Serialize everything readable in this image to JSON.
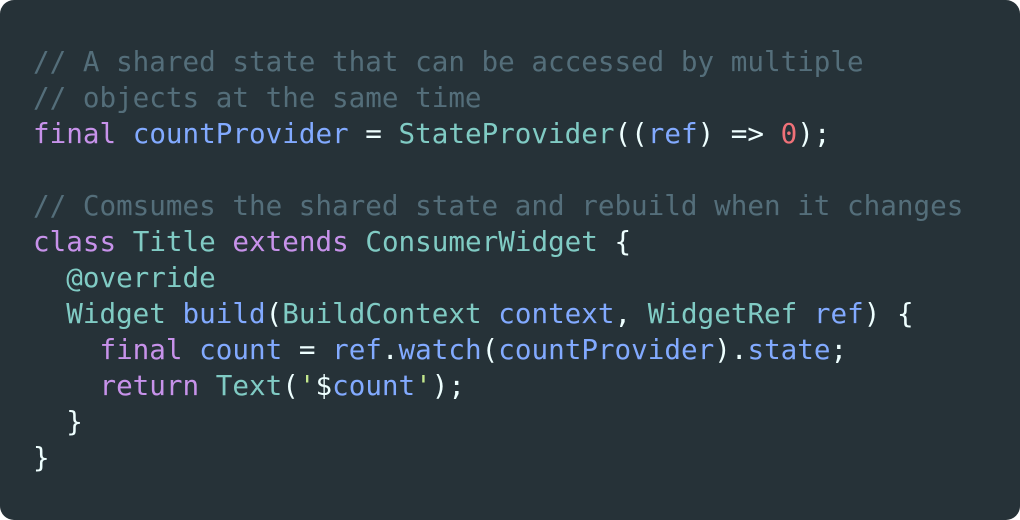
{
  "colors": {
    "background": "#263238",
    "comment": "#546e7a",
    "keyword": "#c792ea",
    "type": "#80cbc4",
    "identifier": "#82aaff",
    "number": "#f07178",
    "string": "#c3e88d",
    "plain": "#eeffff"
  },
  "code": {
    "lines": [
      [
        {
          "t": "// A shared state that can be accessed by multiple",
          "k": "comment"
        }
      ],
      [
        {
          "t": "// objects at the same time",
          "k": "comment"
        }
      ],
      [
        {
          "t": "final",
          "k": "keyword"
        },
        {
          "t": " ",
          "k": "plain"
        },
        {
          "t": "countProvider",
          "k": "identifier"
        },
        {
          "t": " = ",
          "k": "plain"
        },
        {
          "t": "StateProvider",
          "k": "type"
        },
        {
          "t": "((",
          "k": "plain"
        },
        {
          "t": "ref",
          "k": "identifier"
        },
        {
          "t": ") => ",
          "k": "plain"
        },
        {
          "t": "0",
          "k": "number"
        },
        {
          "t": ");",
          "k": "plain"
        }
      ],
      [],
      [
        {
          "t": "// Comsumes the shared state and rebuild when it changes",
          "k": "comment"
        }
      ],
      [
        {
          "t": "class",
          "k": "keyword"
        },
        {
          "t": " ",
          "k": "plain"
        },
        {
          "t": "Title",
          "k": "type"
        },
        {
          "t": " ",
          "k": "plain"
        },
        {
          "t": "extends",
          "k": "keyword"
        },
        {
          "t": " ",
          "k": "plain"
        },
        {
          "t": "ConsumerWidget",
          "k": "type"
        },
        {
          "t": " {",
          "k": "plain"
        }
      ],
      [
        {
          "t": "  ",
          "k": "plain"
        },
        {
          "t": "@override",
          "k": "type"
        }
      ],
      [
        {
          "t": "  ",
          "k": "plain"
        },
        {
          "t": "Widget",
          "k": "type"
        },
        {
          "t": " ",
          "k": "plain"
        },
        {
          "t": "build",
          "k": "identifier"
        },
        {
          "t": "(",
          "k": "plain"
        },
        {
          "t": "BuildContext",
          "k": "type"
        },
        {
          "t": " ",
          "k": "plain"
        },
        {
          "t": "context",
          "k": "identifier"
        },
        {
          "t": ", ",
          "k": "plain"
        },
        {
          "t": "WidgetRef",
          "k": "type"
        },
        {
          "t": " ",
          "k": "plain"
        },
        {
          "t": "ref",
          "k": "identifier"
        },
        {
          "t": ") {",
          "k": "plain"
        }
      ],
      [
        {
          "t": "    ",
          "k": "plain"
        },
        {
          "t": "final",
          "k": "keyword"
        },
        {
          "t": " ",
          "k": "plain"
        },
        {
          "t": "count",
          "k": "identifier"
        },
        {
          "t": " = ",
          "k": "plain"
        },
        {
          "t": "ref",
          "k": "identifier"
        },
        {
          "t": ".",
          "k": "plain"
        },
        {
          "t": "watch",
          "k": "identifier"
        },
        {
          "t": "(",
          "k": "plain"
        },
        {
          "t": "countProvider",
          "k": "identifier"
        },
        {
          "t": ").",
          "k": "plain"
        },
        {
          "t": "state",
          "k": "identifier"
        },
        {
          "t": ";",
          "k": "plain"
        }
      ],
      [
        {
          "t": "    ",
          "k": "plain"
        },
        {
          "t": "return",
          "k": "keyword"
        },
        {
          "t": " ",
          "k": "plain"
        },
        {
          "t": "Text",
          "k": "type"
        },
        {
          "t": "(",
          "k": "plain"
        },
        {
          "t": "'",
          "k": "string"
        },
        {
          "t": "$",
          "k": "plain"
        },
        {
          "t": "count",
          "k": "identifier"
        },
        {
          "t": "'",
          "k": "string"
        },
        {
          "t": ");",
          "k": "plain"
        }
      ],
      [
        {
          "t": "  }",
          "k": "plain"
        }
      ],
      [
        {
          "t": "}",
          "k": "plain"
        }
      ]
    ]
  }
}
